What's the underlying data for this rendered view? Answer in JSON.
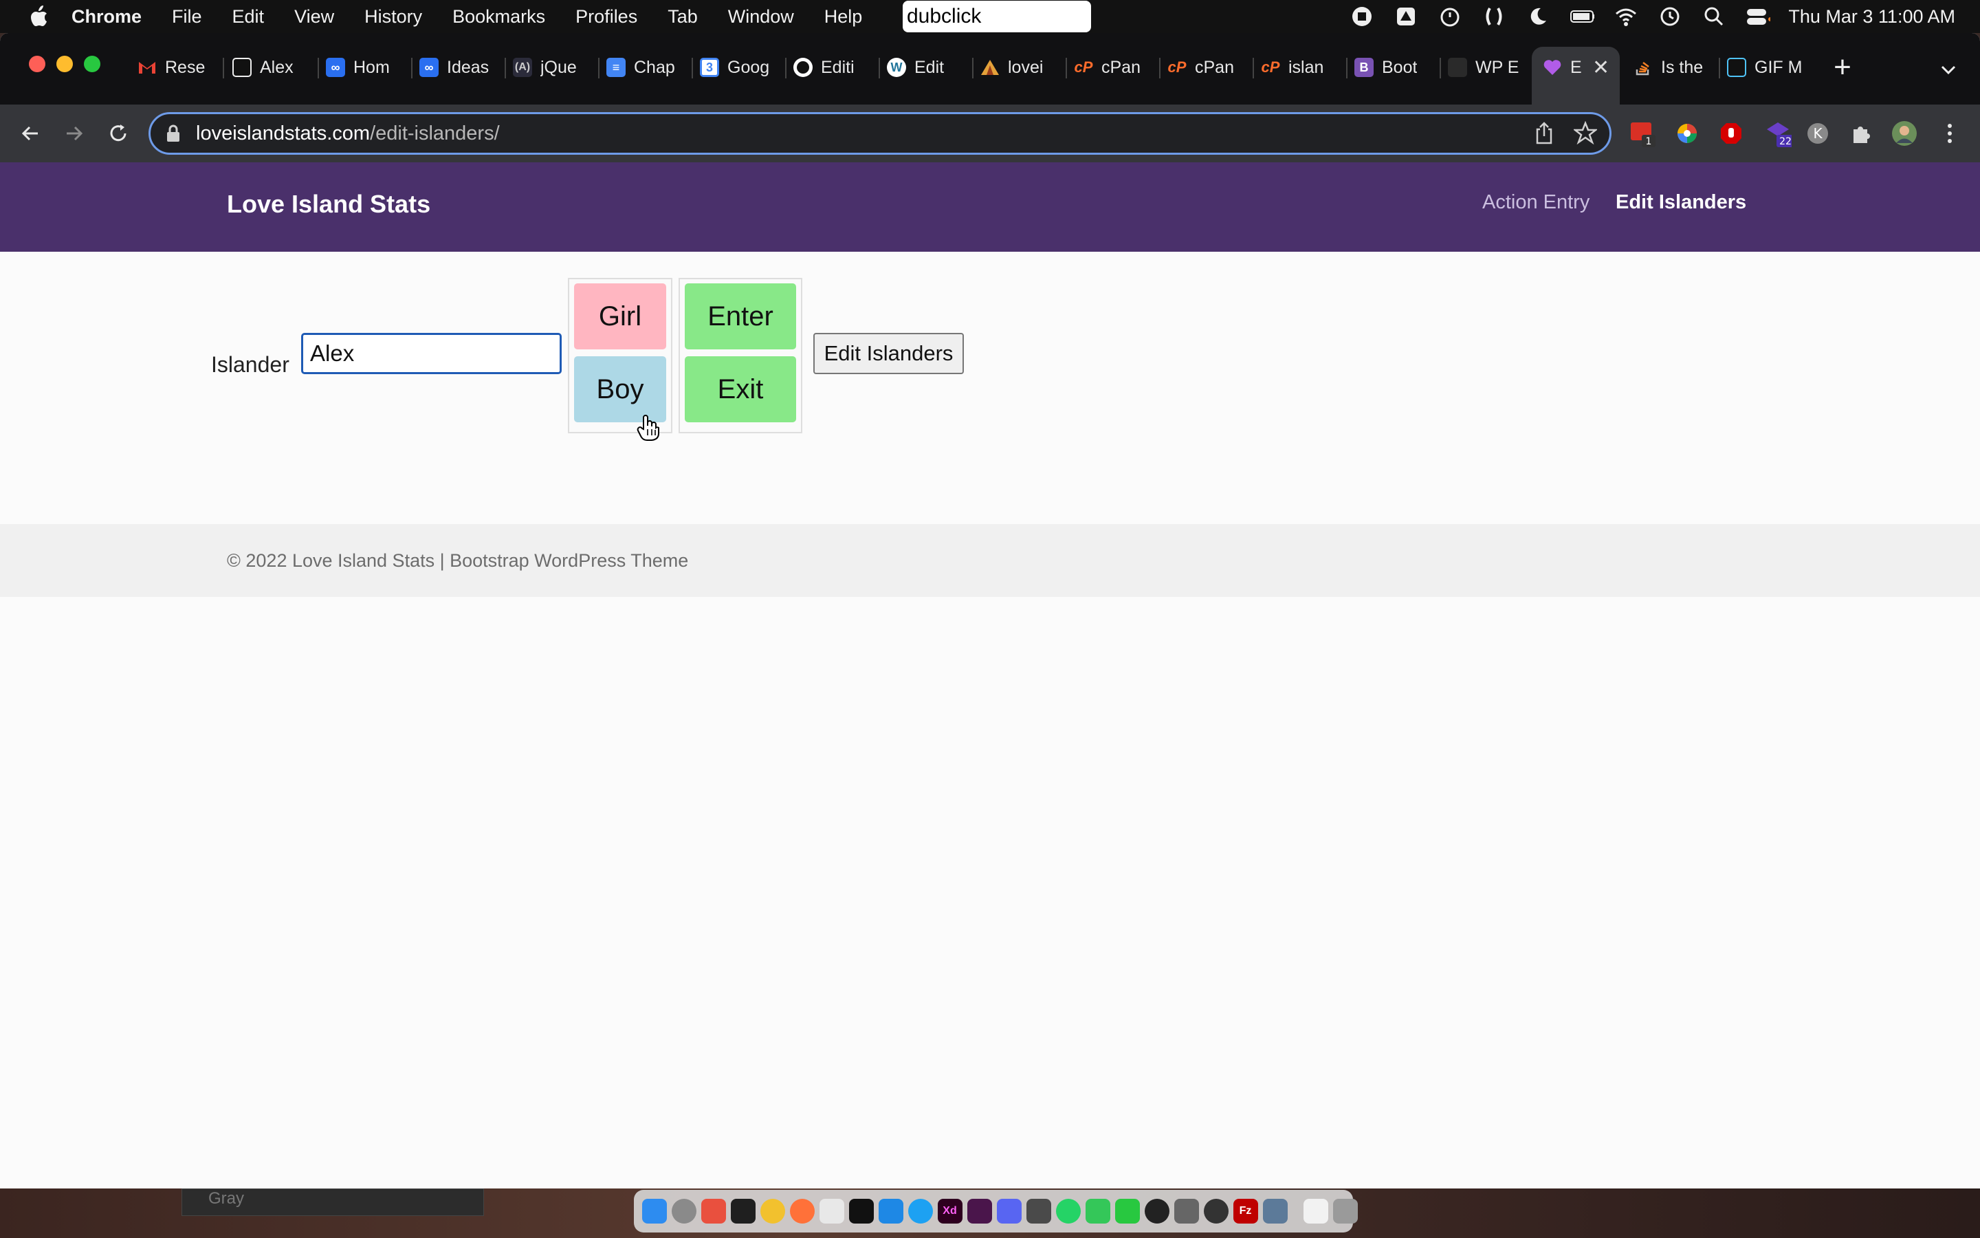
{
  "menubar": {
    "app_name": "Chrome",
    "items": [
      "File",
      "Edit",
      "View",
      "History",
      "Bookmarks",
      "Profiles",
      "Tab",
      "Window",
      "Help"
    ],
    "title_pill": "dubclick",
    "clock": "Thu Mar 3  11:00 AM"
  },
  "tabs": [
    {
      "title": "Rese",
      "icon": "gmail-icon",
      "color": "#ea4335"
    },
    {
      "title": "Alex",
      "icon": "doc-icon",
      "color": "#ffffff"
    },
    {
      "title": "Hom",
      "icon": "infinity-icon",
      "color": "#2a6ff0"
    },
    {
      "title": "Ideas",
      "icon": "infinity-icon",
      "color": "#2a6ff0"
    },
    {
      "title": "jQue",
      "icon": "angular-icon",
      "color": "#333333"
    },
    {
      "title": "Chap",
      "icon": "docs-icon",
      "color": "#4285f4"
    },
    {
      "title": "Goog",
      "icon": "calendar-icon",
      "color": "#4285f4"
    },
    {
      "title": "Editi",
      "icon": "github-icon",
      "color": "#ffffff"
    },
    {
      "title": "Edit",
      "icon": "wordpress-icon",
      "color": "#ffffff"
    },
    {
      "title": "lovei",
      "icon": "tent-icon",
      "color": "#e5a23a"
    },
    {
      "title": "cPan",
      "icon": "cpanel-icon",
      "color": "#ff6c2c"
    },
    {
      "title": "cPan",
      "icon": "cpanel-icon",
      "color": "#ff6c2c"
    },
    {
      "title": "islan",
      "icon": "cpanel-icon",
      "color": "#ff6c2c"
    },
    {
      "title": "Boot",
      "icon": "bootstrap-icon",
      "color": "#7952b3"
    },
    {
      "title": "WP E",
      "icon": "grid-icon",
      "color": "#444444"
    },
    {
      "title": "E",
      "icon": "purple-heart-icon",
      "color": "#b15ce8",
      "active": true
    },
    {
      "title": "Is the",
      "icon": "stackoverflow-icon",
      "color": "#f48024"
    },
    {
      "title": "GIF M",
      "icon": "doc-icon",
      "color": "#ffffff"
    }
  ],
  "omnibox": {
    "host": "loveislandstats.com",
    "path": "/edit-islanders/"
  },
  "extensions": {
    "badge_1": "1",
    "badge_22": "22",
    "profile_letter": "K"
  },
  "site": {
    "brand": "Love Island Stats",
    "nav": [
      "Action Entry",
      "Edit Islanders"
    ]
  },
  "form": {
    "label": "Islander",
    "input_value": "Alex",
    "girl": "Girl",
    "boy": "Boy",
    "enter": "Enter",
    "exit": "Exit",
    "submit": "Edit Islanders"
  },
  "footer": {
    "text": "© 2022 Love Island Stats | Bootstrap WordPress Theme"
  },
  "background_window": {
    "text": "Gray"
  },
  "colors": {
    "brand_bar": "#4a306b",
    "girl": "#ffb6c1",
    "boy": "#add8e6",
    "enter_exit": "#88e888"
  }
}
